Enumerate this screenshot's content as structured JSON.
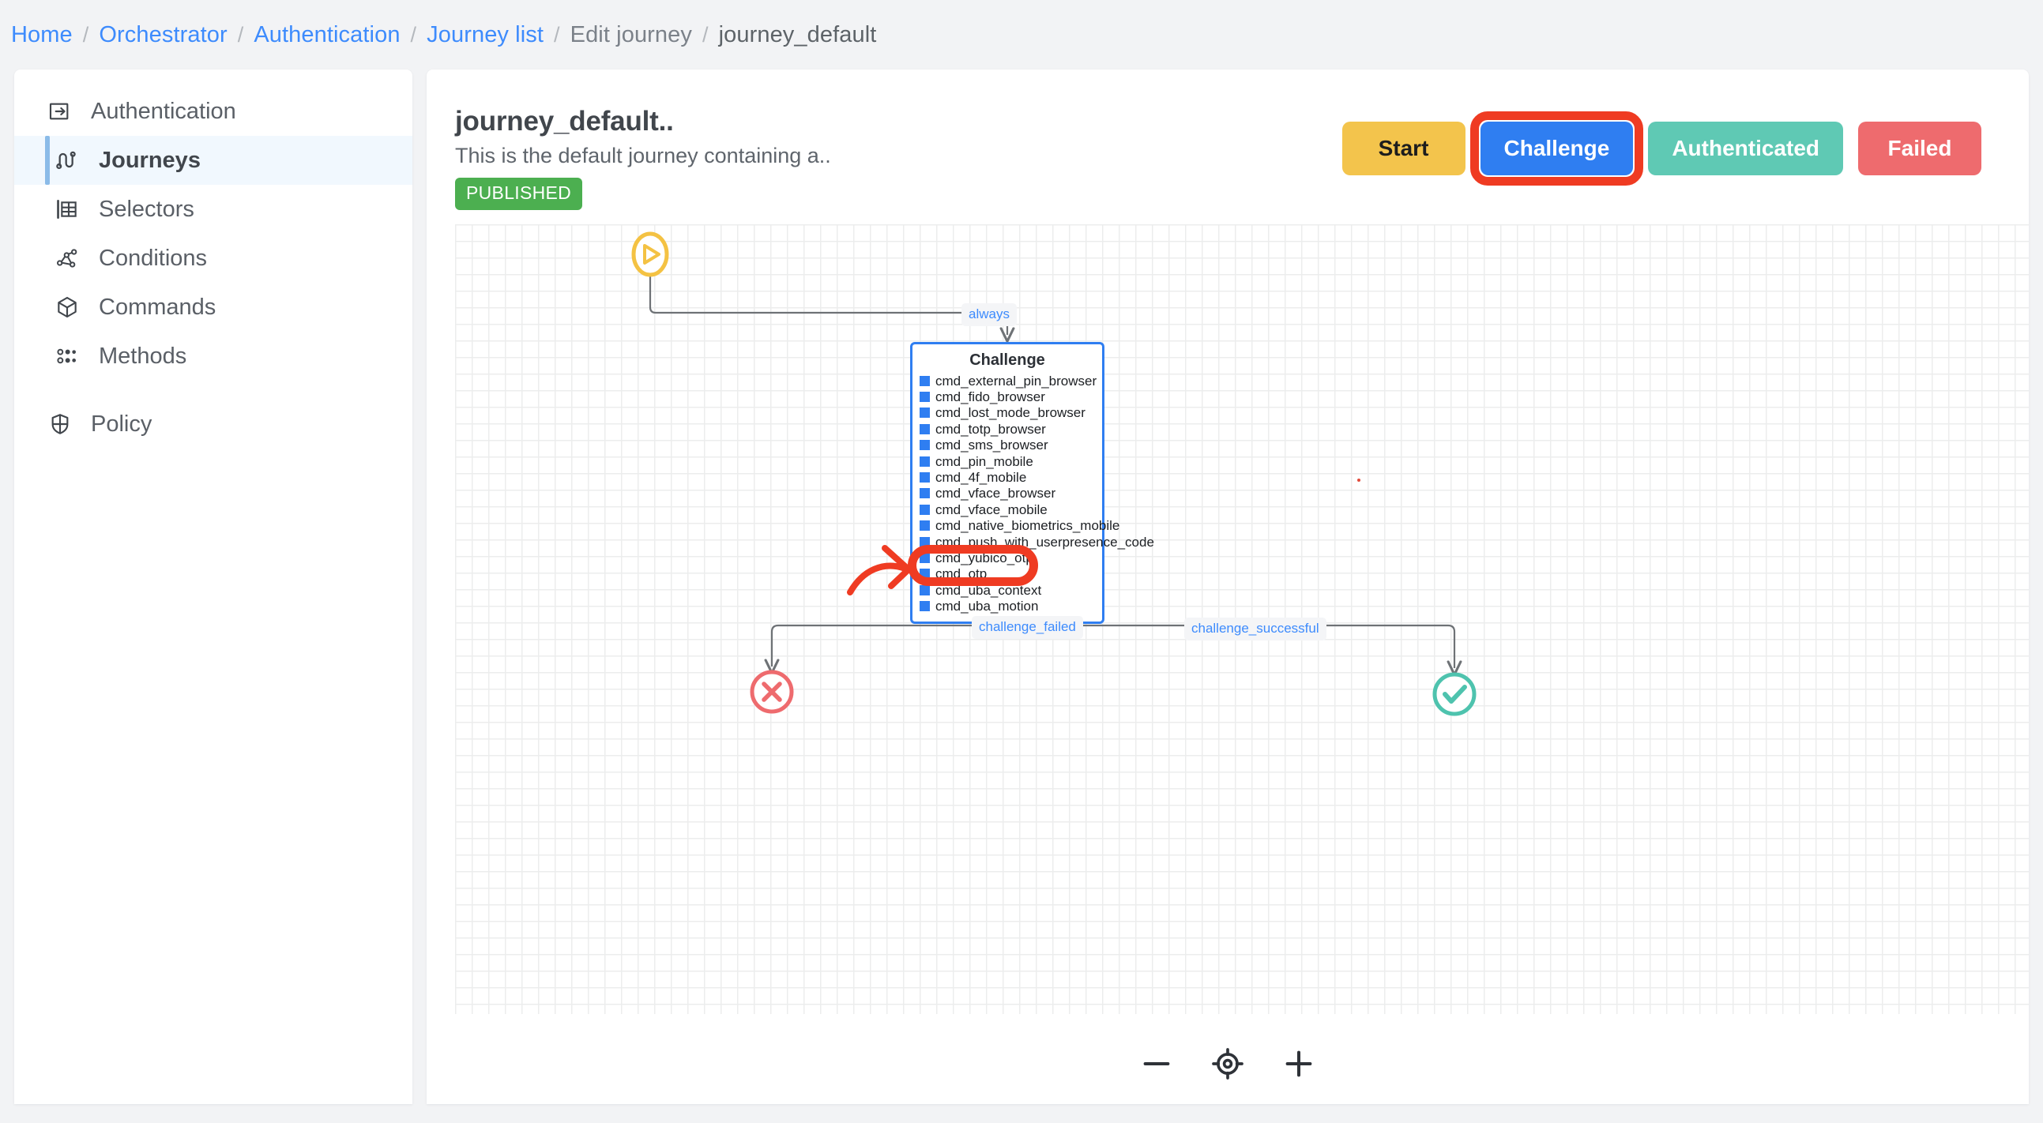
{
  "breadcrumb": {
    "items": [
      {
        "label": "Home",
        "kind": "link"
      },
      {
        "label": "Orchestrator",
        "kind": "link"
      },
      {
        "label": "Authentication",
        "kind": "link"
      },
      {
        "label": "Journey list",
        "kind": "link"
      },
      {
        "label": "Edit journey",
        "kind": "plain"
      },
      {
        "label": "journey_default",
        "kind": "current"
      }
    ],
    "separator": "/"
  },
  "sidebar": {
    "items": [
      {
        "label": "Authentication",
        "icon": "login-arrow-icon",
        "active": false,
        "root": true
      },
      {
        "label": "Journeys",
        "icon": "journey-graph-icon",
        "active": true,
        "root": false
      },
      {
        "label": "Selectors",
        "icon": "table-selector-icon",
        "active": false,
        "root": false
      },
      {
        "label": "Conditions",
        "icon": "conditions-network-icon",
        "active": false,
        "root": false
      },
      {
        "label": "Commands",
        "icon": "cube-icon",
        "active": false,
        "root": false
      },
      {
        "label": "Methods",
        "icon": "dots-grid-icon",
        "active": false,
        "root": false
      },
      {
        "label": "Policy",
        "icon": "shield-icon",
        "active": false,
        "root": true
      }
    ]
  },
  "header": {
    "title": "journey_default..",
    "subtitle": "This is the default journey containing a..",
    "badge": "PUBLISHED",
    "badge_color": "#4caf50"
  },
  "actions": {
    "buttons": [
      {
        "label": "Start",
        "color": "#f3c44c",
        "highlighted": false
      },
      {
        "label": "Challenge",
        "color": "#2f7ef1",
        "highlighted": true
      },
      {
        "label": "Authenticated",
        "color": "#5fc9b4",
        "highlighted": false
      },
      {
        "label": "Failed",
        "color": "#ee6b6e",
        "highlighted": false
      }
    ],
    "highlight_color": "#ef3b22"
  },
  "canvas": {
    "start_node": {
      "icon": "play-circle-icon",
      "color": "#f5c council"
    },
    "nodes": {
      "start": {
        "name": "start",
        "icon": "play-circle-icon",
        "color": "#f4c243"
      },
      "challenge": {
        "title": "Challenge",
        "border_color": "#2f7ef1",
        "swatch_color": "#2f7ef1",
        "commands": [
          "cmd_external_pin_browser",
          "cmd_fido_browser",
          "cmd_lost_mode_browser",
          "cmd_totp_browser",
          "cmd_sms_browser",
          "cmd_pin_mobile",
          "cmd_4f_mobile",
          "cmd_vface_browser",
          "cmd_vface_mobile",
          "cmd_native_biometrics_mobile",
          "cmd_push_with_userpresence_code",
          "cmd_yubico_otp",
          "cmd_otp",
          "cmd_uba_context",
          "cmd_uba_motion"
        ],
        "highlighted_commands": [
          "cmd_uba_context",
          "cmd_uba_motion"
        ]
      },
      "failed": {
        "name": "failed",
        "icon": "x-circle-icon",
        "color": "#ee6b6e"
      },
      "success": {
        "name": "authenticated",
        "icon": "check-circle-icon",
        "color": "#4ec3ae"
      }
    },
    "edges": [
      {
        "label": "always",
        "from": "start",
        "to": "challenge"
      },
      {
        "label": "challenge_failed",
        "from": "challenge",
        "to": "failed"
      },
      {
        "label": "challenge_successful",
        "from": "challenge",
        "to": "success"
      }
    ],
    "edge_label_color": "#3d8bfd",
    "edge_stroke_color": "#6e7276"
  },
  "zoom_controls": {
    "buttons": [
      {
        "name": "zoom-out",
        "glyph": "minus"
      },
      {
        "name": "fit-view",
        "glyph": "crosshair"
      },
      {
        "name": "zoom-in",
        "glyph": "plus"
      }
    ]
  }
}
